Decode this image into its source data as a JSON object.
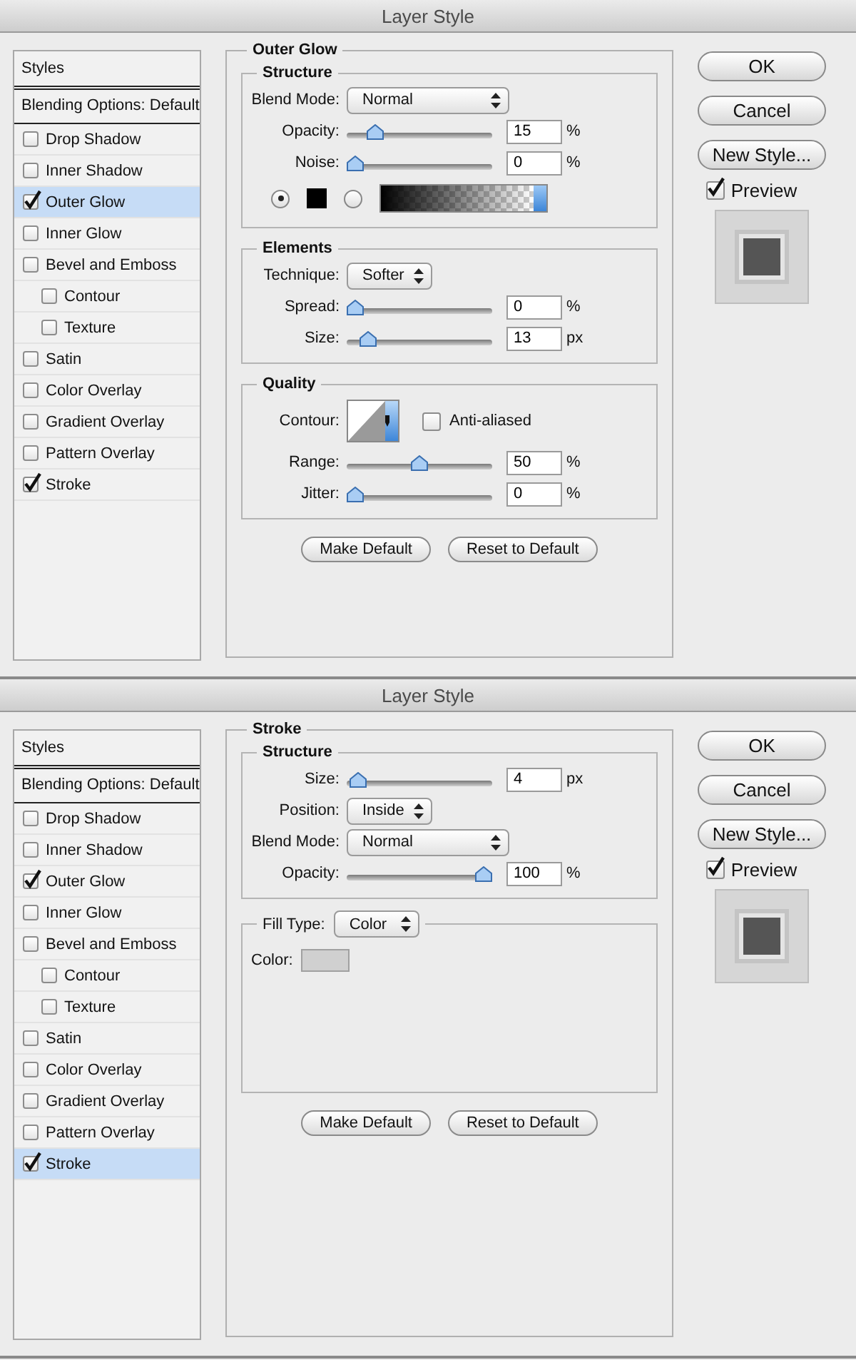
{
  "dialogs": [
    {
      "title": "Layer Style",
      "styles_header": "Styles",
      "blending_options": "Blending Options: Default",
      "styles": [
        {
          "label": "Drop Shadow",
          "checked": false,
          "selected": false
        },
        {
          "label": "Inner Shadow",
          "checked": false,
          "selected": false
        },
        {
          "label": "Outer Glow",
          "checked": true,
          "selected": true
        },
        {
          "label": "Inner Glow",
          "checked": false,
          "selected": false
        },
        {
          "label": "Bevel and Emboss",
          "checked": false,
          "selected": false,
          "children": [
            {
              "label": "Contour",
              "checked": false,
              "selected": false
            },
            {
              "label": "Texture",
              "checked": false,
              "selected": false
            }
          ]
        },
        {
          "label": "Satin",
          "checked": false,
          "selected": false
        },
        {
          "label": "Color Overlay",
          "checked": false,
          "selected": false
        },
        {
          "label": "Gradient Overlay",
          "checked": false,
          "selected": false
        },
        {
          "label": "Pattern Overlay",
          "checked": false,
          "selected": false
        },
        {
          "label": "Stroke",
          "checked": true,
          "selected": false
        }
      ],
      "panel": {
        "title": "Outer Glow",
        "sections": [
          {
            "title": "Structure",
            "rows": [
              {
                "kind": "dropdown",
                "label": "Blend Mode:",
                "value": "Normal"
              },
              {
                "kind": "slider",
                "label": "Opacity:",
                "level": 0.15,
                "value": "15",
                "unit": "%"
              },
              {
                "kind": "slider",
                "label": "Noise:",
                "level": 0,
                "value": "0",
                "unit": "%"
              },
              {
                "kind": "fill-choice",
                "options": [
                  {
                    "kind": "color",
                    "selected": true,
                    "color": "#000000"
                  },
                  {
                    "kind": "gradient",
                    "selected": false
                  }
                ]
              }
            ]
          },
          {
            "title": "Elements",
            "rows": [
              {
                "kind": "short-dropdown",
                "label": "Technique:",
                "value": "Softer"
              },
              {
                "kind": "slider",
                "label": "Spread:",
                "level": 0,
                "value": "0",
                "unit": "%"
              },
              {
                "kind": "slider",
                "label": "Size:",
                "level": 0.1,
                "value": "13",
                "unit": "px"
              }
            ]
          },
          {
            "title": "Quality",
            "rows": [
              {
                "kind": "contour",
                "label": "Contour:",
                "option": {
                  "label": "Anti-aliased",
                  "checked": false
                }
              },
              {
                "kind": "slider",
                "label": "Range:",
                "level": 0.5,
                "value": "50",
                "unit": "%"
              },
              {
                "kind": "slider",
                "label": "Jitter:",
                "level": 0,
                "value": "0",
                "unit": "%"
              }
            ]
          }
        ],
        "buttons": [
          "Make Default",
          "Reset to Default"
        ]
      },
      "actions": [
        "OK",
        "Cancel",
        "New Style..."
      ],
      "preview": {
        "label": "Preview",
        "checked": true
      }
    },
    {
      "title": "Layer Style",
      "styles_header": "Styles",
      "blending_options": "Blending Options: Default",
      "styles": [
        {
          "label": "Drop Shadow",
          "checked": false,
          "selected": false
        },
        {
          "label": "Inner Shadow",
          "checked": false,
          "selected": false
        },
        {
          "label": "Outer Glow",
          "checked": true,
          "selected": false
        },
        {
          "label": "Inner Glow",
          "checked": false,
          "selected": false
        },
        {
          "label": "Bevel and Emboss",
          "checked": false,
          "selected": false,
          "children": [
            {
              "label": "Contour",
              "checked": false,
              "selected": false
            },
            {
              "label": "Texture",
              "checked": false,
              "selected": false
            }
          ]
        },
        {
          "label": "Satin",
          "checked": false,
          "selected": false
        },
        {
          "label": "Color Overlay",
          "checked": false,
          "selected": false
        },
        {
          "label": "Gradient Overlay",
          "checked": false,
          "selected": false
        },
        {
          "label": "Pattern Overlay",
          "checked": false,
          "selected": false
        },
        {
          "label": "Stroke",
          "checked": true,
          "selected": true
        }
      ],
      "panel": {
        "title": "Stroke",
        "sections": [
          {
            "title": "Structure",
            "rows": [
              {
                "kind": "slider",
                "label": "Size:",
                "level": 0.02,
                "value": "4",
                "unit": "px"
              },
              {
                "kind": "short-dropdown",
                "label": "Position:",
                "value": "Inside"
              },
              {
                "kind": "dropdown",
                "label": "Blend Mode:",
                "value": "Normal"
              },
              {
                "kind": "slider",
                "label": "Opacity:",
                "level": 1,
                "value": "100",
                "unit": "%"
              }
            ]
          },
          {
            "legend": {
              "label": "Fill Type:",
              "value": "Color"
            },
            "rows": [
              {
                "kind": "color",
                "label": "Color:",
                "color": "#d0d0d0"
              }
            ]
          }
        ],
        "buttons": [
          "Make Default",
          "Reset to Default"
        ]
      },
      "actions": [
        "OK",
        "Cancel",
        "New Style..."
      ],
      "preview": {
        "label": "Preview",
        "checked": true
      }
    }
  ]
}
